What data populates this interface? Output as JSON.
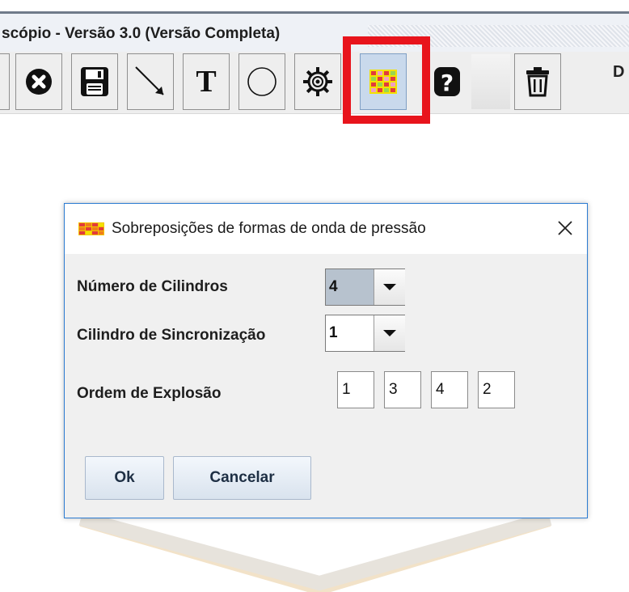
{
  "window": {
    "title": "scópio - Versão 3.0 (Versão Completa)",
    "right_fragment": "D"
  },
  "toolbar": {
    "buttons": [
      {
        "name": "close-icon"
      },
      {
        "name": "save-icon"
      },
      {
        "name": "arrow-icon"
      },
      {
        "name": "text-icon",
        "glyph": "T"
      },
      {
        "name": "circle-icon"
      },
      {
        "name": "gear-icon"
      },
      {
        "name": "overlay-grid-icon"
      },
      {
        "name": "help-icon"
      },
      {
        "name": "trash-icon"
      }
    ],
    "highlight_color": "#e8141c"
  },
  "dialog": {
    "title": "Sobreposições de formas de onda de pressão",
    "close_glyph": "✕",
    "fields": {
      "num_cylinders_label": "Número de Cilindros",
      "num_cylinders_value": "4",
      "sync_cylinder_label": "Cilindro de Sincronização",
      "sync_cylinder_value": "1",
      "firing_order_label": "Ordem de Explosão",
      "firing_order": [
        "1",
        "3",
        "4",
        "2"
      ]
    },
    "buttons": {
      "ok": "Ok",
      "cancel": "Cancelar"
    },
    "accent": "#2b7bd2"
  }
}
